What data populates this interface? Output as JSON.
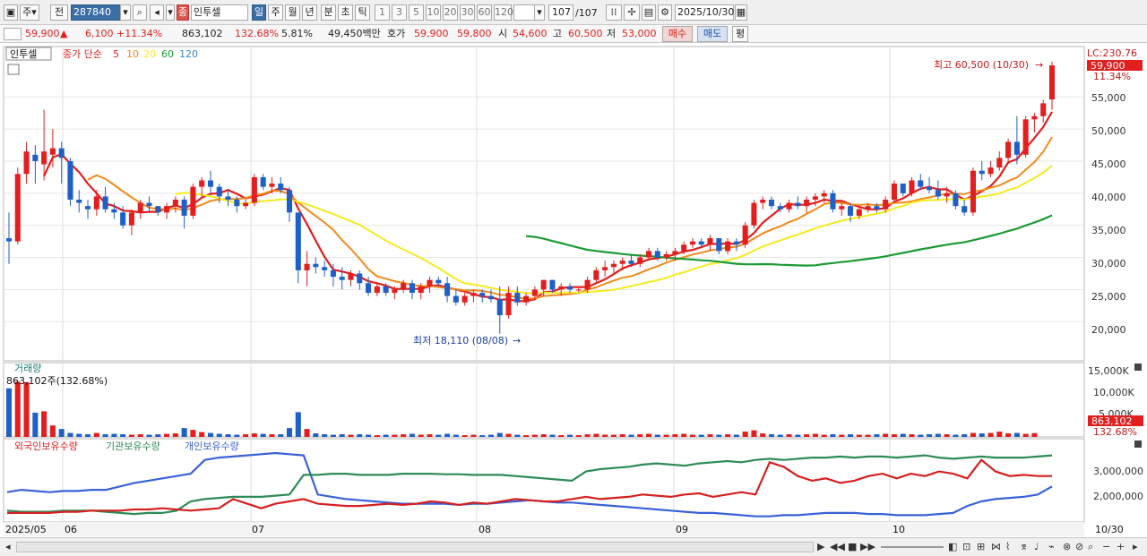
{
  "toolbar": {
    "period_label": "주",
    "prev_label": "전",
    "code": "287840",
    "name": "인투셀",
    "stock_marker": "종",
    "interval_buttons": [
      "일",
      "주",
      "월",
      "년",
      "분",
      "초",
      "틱"
    ],
    "selected_interval": "일",
    "minute_buttons": [
      "1",
      "3",
      "5",
      "10",
      "20",
      "30",
      "60",
      "120"
    ],
    "count_current": "107",
    "count_total": "/107",
    "date": "2025/10/30"
  },
  "quote": {
    "price": "59,900",
    "change_arrow": "▲",
    "change": "6,100",
    "change_pct": "+11.34%",
    "volume": "863,102",
    "vol_ratio": "132.68%",
    "turnover": "5.81%",
    "amount": "49,450백만",
    "bid_label": "호가",
    "ask": "59,900",
    "bid": "59,800",
    "open_label": "시",
    "open": "54,600",
    "high_label": "고",
    "high": "60,500",
    "low_label": "저",
    "low": "53,000",
    "buy_label": "매수",
    "sell_label": "매도",
    "avg_label": "평"
  },
  "price_panel": {
    "name_tag": "인투셀",
    "legend_prefix": "종가 단순",
    "ma_labels": [
      "5",
      "10",
      "20",
      "60",
      "120"
    ],
    "lc_label": "LC:230.76",
    "last_price_tag": "59,900",
    "pct_tag": "11.34%",
    "high_annotation": "최고 60,500 (10/30)",
    "low_annotation": "최저 18,110 (08/08)",
    "y_ticks": [
      "55,000",
      "50,000",
      "45,000",
      "40,000",
      "35,000",
      "30,000",
      "25,000",
      "20,000"
    ]
  },
  "volume_panel": {
    "title": "거래량",
    "summary": "863,102주(132.68%)",
    "y_ticks": [
      "15,000K",
      "10,000K",
      "5,000K"
    ],
    "last_tag": "863,102",
    "pct_tag": "132.68%"
  },
  "holdings_panel": {
    "legend": [
      "외국인보유수량",
      "기관보유수량",
      "개인보유수량"
    ],
    "y_ticks": [
      "3,000,000",
      "2,000,000"
    ]
  },
  "x_axis": {
    "labels": [
      "2025/05",
      "06",
      "07",
      "08",
      "09",
      "10"
    ],
    "last_date": "10/30"
  },
  "colors": {
    "up": "#e21e1e",
    "down": "#1f5fc8",
    "ma5": "#e21e1e",
    "ma10": "#f08a1c",
    "ma20": "#f5ea22",
    "ma60": "#1c9a36",
    "ma120": "#3a87c8",
    "foreign": "#d42020",
    "institution": "#2e8b57",
    "individual": "#3a62d8"
  },
  "chart_data": {
    "type": "candlestick",
    "price_ylim": [
      16000,
      62000
    ],
    "candles": [
      [
        33000,
        37000,
        29000,
        32500
      ],
      [
        32500,
        44000,
        32000,
        43000
      ],
      [
        43000,
        48000,
        41500,
        46500
      ],
      [
        46000,
        47500,
        41500,
        45000
      ],
      [
        44500,
        53000,
        42000,
        46500
      ],
      [
        46000,
        50000,
        44000,
        47000
      ],
      [
        47000,
        48000,
        41500,
        45500
      ],
      [
        45000,
        45500,
        38000,
        39000
      ],
      [
        39000,
        40500,
        37000,
        38500
      ],
      [
        38000,
        39000,
        36000,
        37500
      ],
      [
        37500,
        40500,
        36500,
        39500
      ],
      [
        39500,
        41000,
        37000,
        37500
      ],
      [
        37500,
        38500,
        36000,
        37000
      ],
      [
        37000,
        38000,
        34500,
        35000
      ],
      [
        35000,
        37500,
        33500,
        37000
      ],
      [
        37000,
        39000,
        36000,
        38500
      ],
      [
        38500,
        39500,
        37000,
        38000
      ],
      [
        38000,
        38000,
        36500,
        37000
      ],
      [
        37000,
        38500,
        36000,
        38000
      ],
      [
        38000,
        39500,
        37000,
        39000
      ],
      [
        39000,
        39500,
        34500,
        36500
      ],
      [
        36500,
        41500,
        36000,
        41000
      ],
      [
        41000,
        42500,
        39500,
        42000
      ],
      [
        42000,
        43500,
        40000,
        41000
      ],
      [
        41000,
        41500,
        38500,
        39500
      ],
      [
        39500,
        40500,
        38000,
        39000
      ],
      [
        39000,
        39500,
        37000,
        38000
      ],
      [
        38000,
        39000,
        37500,
        38500
      ],
      [
        38500,
        43000,
        38000,
        42500
      ],
      [
        42500,
        43000,
        40500,
        41000
      ],
      [
        41000,
        42500,
        40000,
        41500
      ],
      [
        41500,
        42500,
        40000,
        40500
      ],
      [
        40500,
        41000,
        35500,
        37000
      ],
      [
        37000,
        37000,
        26000,
        28000
      ],
      [
        28000,
        31000,
        25500,
        29000
      ],
      [
        29000,
        30000,
        27500,
        28500
      ],
      [
        28500,
        29500,
        27000,
        28000
      ],
      [
        28000,
        29000,
        25500,
        27000
      ],
      [
        27000,
        28500,
        25000,
        26500
      ],
      [
        26500,
        28000,
        25500,
        27500
      ],
      [
        27500,
        28000,
        25000,
        26000
      ],
      [
        26000,
        27000,
        24000,
        24500
      ],
      [
        24500,
        26000,
        24000,
        25500
      ],
      [
        25500,
        26000,
        24000,
        24500
      ],
      [
        24500,
        25500,
        23500,
        25000
      ],
      [
        25000,
        26500,
        24500,
        26000
      ],
      [
        26000,
        26500,
        23500,
        24500
      ],
      [
        24500,
        26000,
        23500,
        25500
      ],
      [
        25500,
        27000,
        24500,
        26500
      ],
      [
        26500,
        27000,
        25500,
        26000
      ],
      [
        26000,
        27000,
        23000,
        24000
      ],
      [
        24000,
        25000,
        22500,
        23000
      ],
      [
        23000,
        24500,
        22500,
        24000
      ],
      [
        24000,
        25000,
        23000,
        24500
      ],
      [
        24500,
        25000,
        23000,
        24000
      ],
      [
        24000,
        25000,
        23000,
        23500
      ],
      [
        23500,
        25500,
        18110,
        21000
      ],
      [
        21000,
        25500,
        20500,
        24500
      ],
      [
        24500,
        25500,
        22500,
        23000
      ],
      [
        23000,
        24500,
        22500,
        24000
      ],
      [
        24000,
        25500,
        23500,
        25000
      ],
      [
        25000,
        26500,
        24000,
        26500
      ],
      [
        26500,
        26500,
        24500,
        25000
      ],
      [
        25000,
        26000,
        24000,
        25500
      ],
      [
        25500,
        26000,
        24500,
        25000
      ],
      [
        25000,
        25500,
        24500,
        25000
      ],
      [
        25000,
        27000,
        24500,
        26500
      ],
      [
        26500,
        28500,
        26000,
        28000
      ],
      [
        28000,
        29500,
        27000,
        28500
      ],
      [
        28500,
        29500,
        27500,
        29000
      ],
      [
        29000,
        30000,
        28000,
        29500
      ],
      [
        29500,
        30500,
        28500,
        29000
      ],
      [
        29000,
        30500,
        28500,
        30000
      ],
      [
        30000,
        31500,
        29500,
        31000
      ],
      [
        31000,
        31500,
        29500,
        30000
      ],
      [
        30000,
        31000,
        29500,
        30500
      ],
      [
        30500,
        31500,
        29500,
        31000
      ],
      [
        31000,
        32500,
        30500,
        32000
      ],
      [
        32000,
        33000,
        31500,
        32500
      ],
      [
        32500,
        33000,
        31500,
        32000
      ],
      [
        32000,
        33500,
        31000,
        33000
      ],
      [
        33000,
        33000,
        30500,
        31000
      ],
      [
        31000,
        33000,
        30500,
        32500
      ],
      [
        32500,
        33000,
        31000,
        32000
      ],
      [
        32000,
        35500,
        31500,
        35000
      ],
      [
        35000,
        39000,
        34500,
        38500
      ],
      [
        38500,
        39500,
        37500,
        39000
      ],
      [
        39000,
        39500,
        37500,
        38000
      ],
      [
        38000,
        38500,
        37000,
        37500
      ],
      [
        37500,
        39000,
        37000,
        38500
      ],
      [
        38500,
        39500,
        37500,
        38000
      ],
      [
        38000,
        39500,
        37000,
        39000
      ],
      [
        39000,
        40000,
        38000,
        39500
      ],
      [
        39500,
        40500,
        38500,
        40000
      ],
      [
        40000,
        40500,
        37000,
        37500
      ],
      [
        37500,
        38500,
        36500,
        38000
      ],
      [
        38000,
        38500,
        35500,
        36500
      ],
      [
        36500,
        38000,
        36000,
        37500
      ],
      [
        37500,
        38500,
        37000,
        38000
      ],
      [
        38000,
        38500,
        37000,
        37500
      ],
      [
        37500,
        39500,
        37000,
        39000
      ],
      [
        39000,
        42000,
        38500,
        41500
      ],
      [
        41500,
        41500,
        39500,
        40000
      ],
      [
        40000,
        42500,
        39500,
        42000
      ],
      [
        42000,
        43000,
        40500,
        41000
      ],
      [
        41000,
        42500,
        40000,
        40500
      ],
      [
        40500,
        42000,
        39000,
        39500
      ]
    ],
    "closing_week": [
      [
        39500,
        41000,
        38500,
        40000
      ],
      [
        40000,
        40500,
        37500,
        38000
      ],
      [
        38000,
        39000,
        36500,
        37000
      ],
      [
        37000,
        44000,
        36500,
        43500
      ],
      [
        43500,
        45000,
        42000,
        43000
      ],
      [
        43000,
        45000,
        42500,
        44000
      ],
      [
        44000,
        46500,
        43500,
        45500
      ],
      [
        45500,
        48500,
        44500,
        48000
      ],
      [
        48000,
        52000,
        44500,
        46000
      ],
      [
        46000,
        52000,
        45500,
        51500
      ],
      [
        51500,
        52500,
        49500,
        52000
      ],
      [
        52000,
        54500,
        51000,
        54000
      ],
      [
        54600,
        60500,
        53000,
        59900
      ]
    ],
    "volume": [
      11000,
      12500,
      12400,
      5500,
      5800,
      2600,
      1800,
      900,
      700,
      600,
      900,
      600,
      700,
      600,
      500,
      600,
      500,
      600,
      700,
      800,
      2000,
      1600,
      1100,
      900,
      700,
      600,
      500,
      600,
      800,
      700,
      600,
      600,
      2000,
      5600,
      1800,
      800,
      600,
      500,
      600,
      500,
      600,
      500,
      400,
      500,
      500,
      600,
      700,
      500,
      600,
      500,
      700,
      500,
      400,
      500,
      400,
      500,
      900,
      700,
      500,
      400,
      500,
      600,
      500,
      400,
      500,
      400,
      600,
      700,
      500,
      500,
      600,
      500,
      600,
      700,
      500,
      500,
      600,
      700,
      500,
      500,
      600,
      500,
      600,
      500,
      1200,
      1500,
      800,
      600,
      500,
      600,
      500,
      600,
      700,
      500,
      600,
      500,
      600,
      500,
      500,
      600,
      700,
      600,
      700,
      600,
      500,
      600,
      700,
      600,
      500,
      600,
      900,
      800,
      900,
      1200,
      800,
      900,
      700,
      863
    ],
    "holdings": {
      "foreign": [
        1300,
        1300,
        1300,
        1300,
        1350,
        1350,
        1400,
        1400,
        1400,
        1450,
        1450,
        1500,
        1450,
        1400,
        1450,
        1500,
        1900,
        1700,
        1500,
        1700,
        1800,
        1900,
        1700,
        1650,
        1600,
        1600,
        1650,
        1700,
        1650,
        1700,
        1800,
        1750,
        1650,
        1750,
        1700,
        1800,
        1900,
        1850,
        1800,
        1800,
        1900,
        2000,
        1900,
        1950,
        2000,
        2100,
        2050,
        2000,
        2100,
        2150,
        2000,
        2100,
        2200,
        2100,
        3500,
        3300,
        2900,
        2700,
        2800,
        2600,
        2700,
        2900,
        3000,
        2800,
        3000,
        2900,
        3100,
        3000,
        2800,
        3600,
        3100,
        2900,
        2950,
        2900,
        2900
      ],
      "institution": [
        1400,
        1350,
        1350,
        1350,
        1400,
        1400,
        1400,
        1350,
        1300,
        1250,
        1300,
        1300,
        1400,
        1800,
        1900,
        1950,
        2000,
        2000,
        2000,
        2050,
        2100,
        2950,
        2950,
        3000,
        3000,
        2950,
        2950,
        2950,
        3000,
        3000,
        3000,
        2980,
        2980,
        2950,
        2950,
        2950,
        2900,
        2850,
        2800,
        2750,
        2700,
        3100,
        3200,
        3250,
        3300,
        3400,
        3450,
        3400,
        3350,
        3450,
        3500,
        3550,
        3500,
        3600,
        3650,
        3600,
        3650,
        3700,
        3700,
        3750,
        3700,
        3750,
        3750,
        3700,
        3750,
        3800,
        3700,
        3650,
        3700,
        3750,
        3700,
        3700,
        3700,
        3750,
        3800
      ],
      "individual": [
        2200,
        2300,
        2250,
        2200,
        2250,
        2250,
        2300,
        2300,
        2450,
        2600,
        2700,
        2800,
        2900,
        3000,
        3600,
        3700,
        3750,
        3800,
        3850,
        3900,
        3850,
        3800,
        2100,
        2000,
        1900,
        1850,
        1800,
        1750,
        1700,
        1700,
        1700,
        1700,
        1650,
        1700,
        1700,
        1750,
        1800,
        1850,
        1800,
        1750,
        1750,
        1700,
        1650,
        1600,
        1550,
        1500,
        1450,
        1400,
        1350,
        1300,
        1300,
        1250,
        1200,
        1150,
        1150,
        1200,
        1200,
        1250,
        1300,
        1300,
        1300,
        1250,
        1250,
        1200,
        1200,
        1200,
        1250,
        1300,
        1600,
        1800,
        1900,
        1950,
        2000,
        2100,
        2450
      ]
    }
  }
}
